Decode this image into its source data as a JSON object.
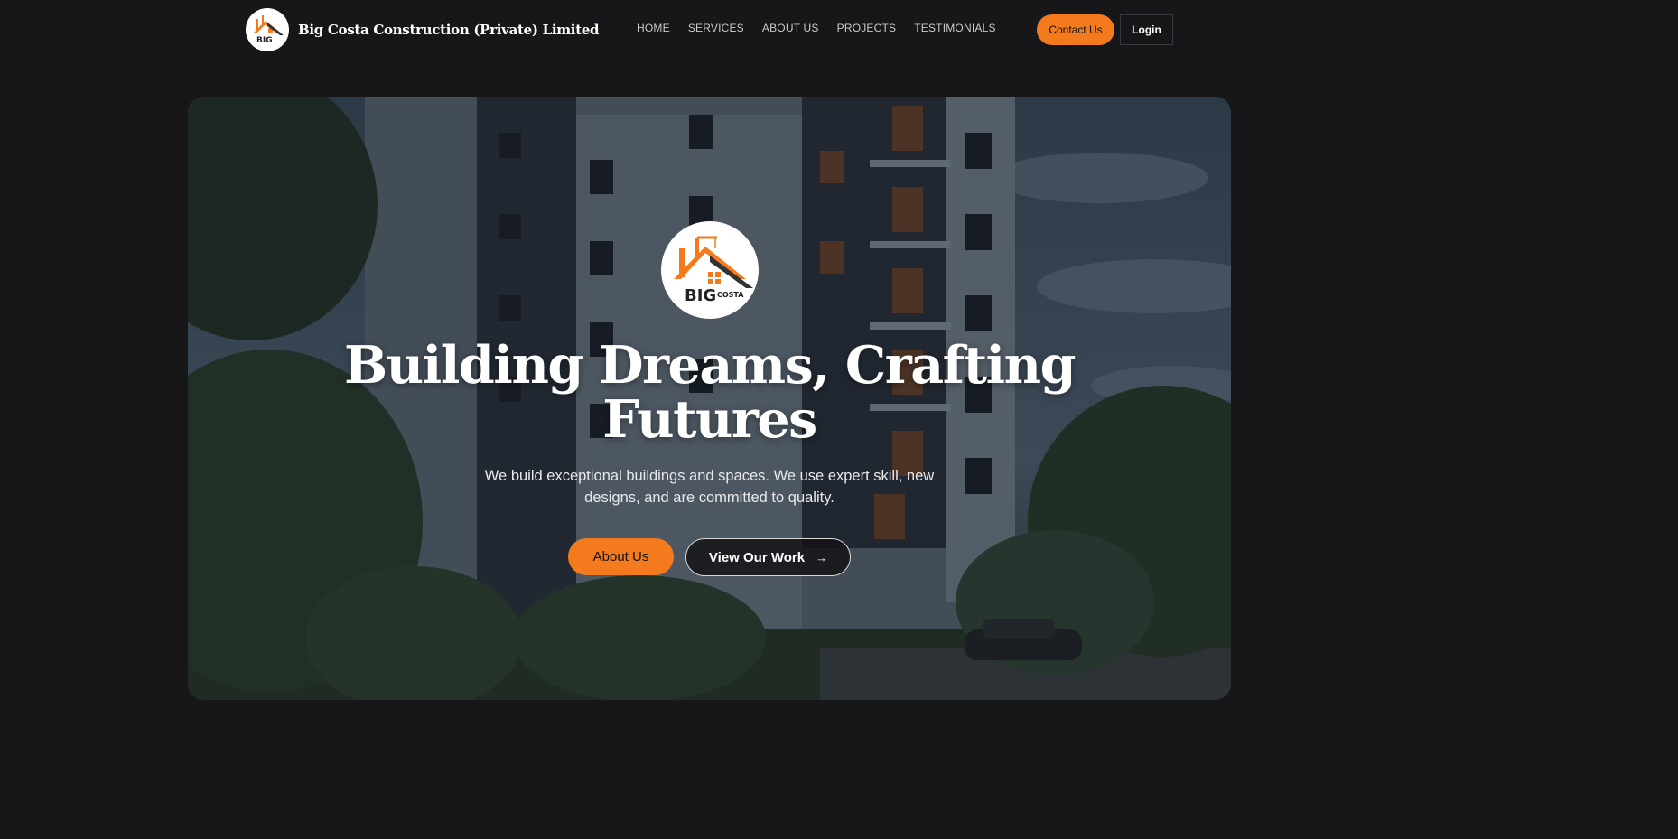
{
  "header": {
    "brand_name": "Big Costa Construction (Private) Limited",
    "nav": [
      {
        "label": "HOME"
      },
      {
        "label": "SERVICES"
      },
      {
        "label": "ABOUT US"
      },
      {
        "label": "PROJECTS"
      },
      {
        "label": "TESTIMONIALS"
      }
    ],
    "contact_label": "Contact Us",
    "login_label": "Login"
  },
  "hero": {
    "logo_text": "BIG",
    "logo_subtext": "COSTA",
    "headline_line1": "Building Dreams, Crafting",
    "headline_line2": "Futures",
    "subtext": "We build exceptional buildings and spaces. We use expert skill, new designs, and are committed to quality.",
    "about_label": "About Us",
    "work_label": "View Our Work",
    "work_icon": "arrow-right-icon"
  },
  "colors": {
    "accent": "#f47a1e",
    "background": "#171719"
  }
}
